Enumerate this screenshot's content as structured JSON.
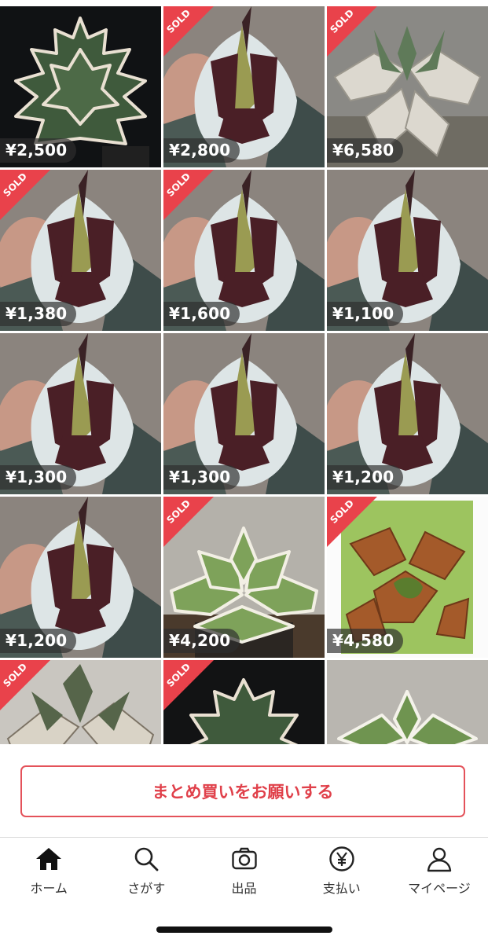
{
  "items": [
    {
      "price": "¥2,500",
      "sold": false,
      "image": "agave-variegated-dark"
    },
    {
      "price": "¥2,800",
      "sold": true,
      "image": "agave-silver-hand"
    },
    {
      "price": "¥6,580",
      "sold": true,
      "image": "agave-white-curly"
    },
    {
      "price": "¥1,380",
      "sold": true,
      "image": "agave-silver-hand"
    },
    {
      "price": "¥1,600",
      "sold": true,
      "image": "agave-silver-hand"
    },
    {
      "price": "¥1,100",
      "sold": false,
      "image": "agave-silver-hand"
    },
    {
      "price": "¥1,300",
      "sold": false,
      "image": "agave-silver-hand"
    },
    {
      "price": "¥1,300",
      "sold": false,
      "image": "agave-silver-hand"
    },
    {
      "price": "¥1,200",
      "sold": false,
      "image": "agave-silver-hand"
    },
    {
      "price": "¥1,200",
      "sold": false,
      "image": "agave-silver-hand"
    },
    {
      "price": "¥4,200",
      "sold": true,
      "image": "agave-green-white-pot"
    },
    {
      "price": "¥4,580",
      "sold": true,
      "image": "agave-rust-green"
    },
    {
      "price": "",
      "sold": true,
      "image": "agave-white-curly"
    },
    {
      "price": "",
      "sold": true,
      "image": "agave-variegated-dark"
    },
    {
      "price": "",
      "sold": false,
      "image": "agave-green-white-pot"
    }
  ],
  "sold_label": "SOLD",
  "bulk_button": "まとめ買いをお願いする",
  "tabbar": [
    {
      "label": "ホーム",
      "icon": "home-icon"
    },
    {
      "label": "さがす",
      "icon": "search-icon"
    },
    {
      "label": "出品",
      "icon": "camera-icon"
    },
    {
      "label": "支払い",
      "icon": "yen-icon"
    },
    {
      "label": "マイページ",
      "icon": "person-icon"
    }
  ],
  "colors": {
    "accent": "#e4525a",
    "sold_ribbon": "#e9424b",
    "text": "#333333"
  }
}
